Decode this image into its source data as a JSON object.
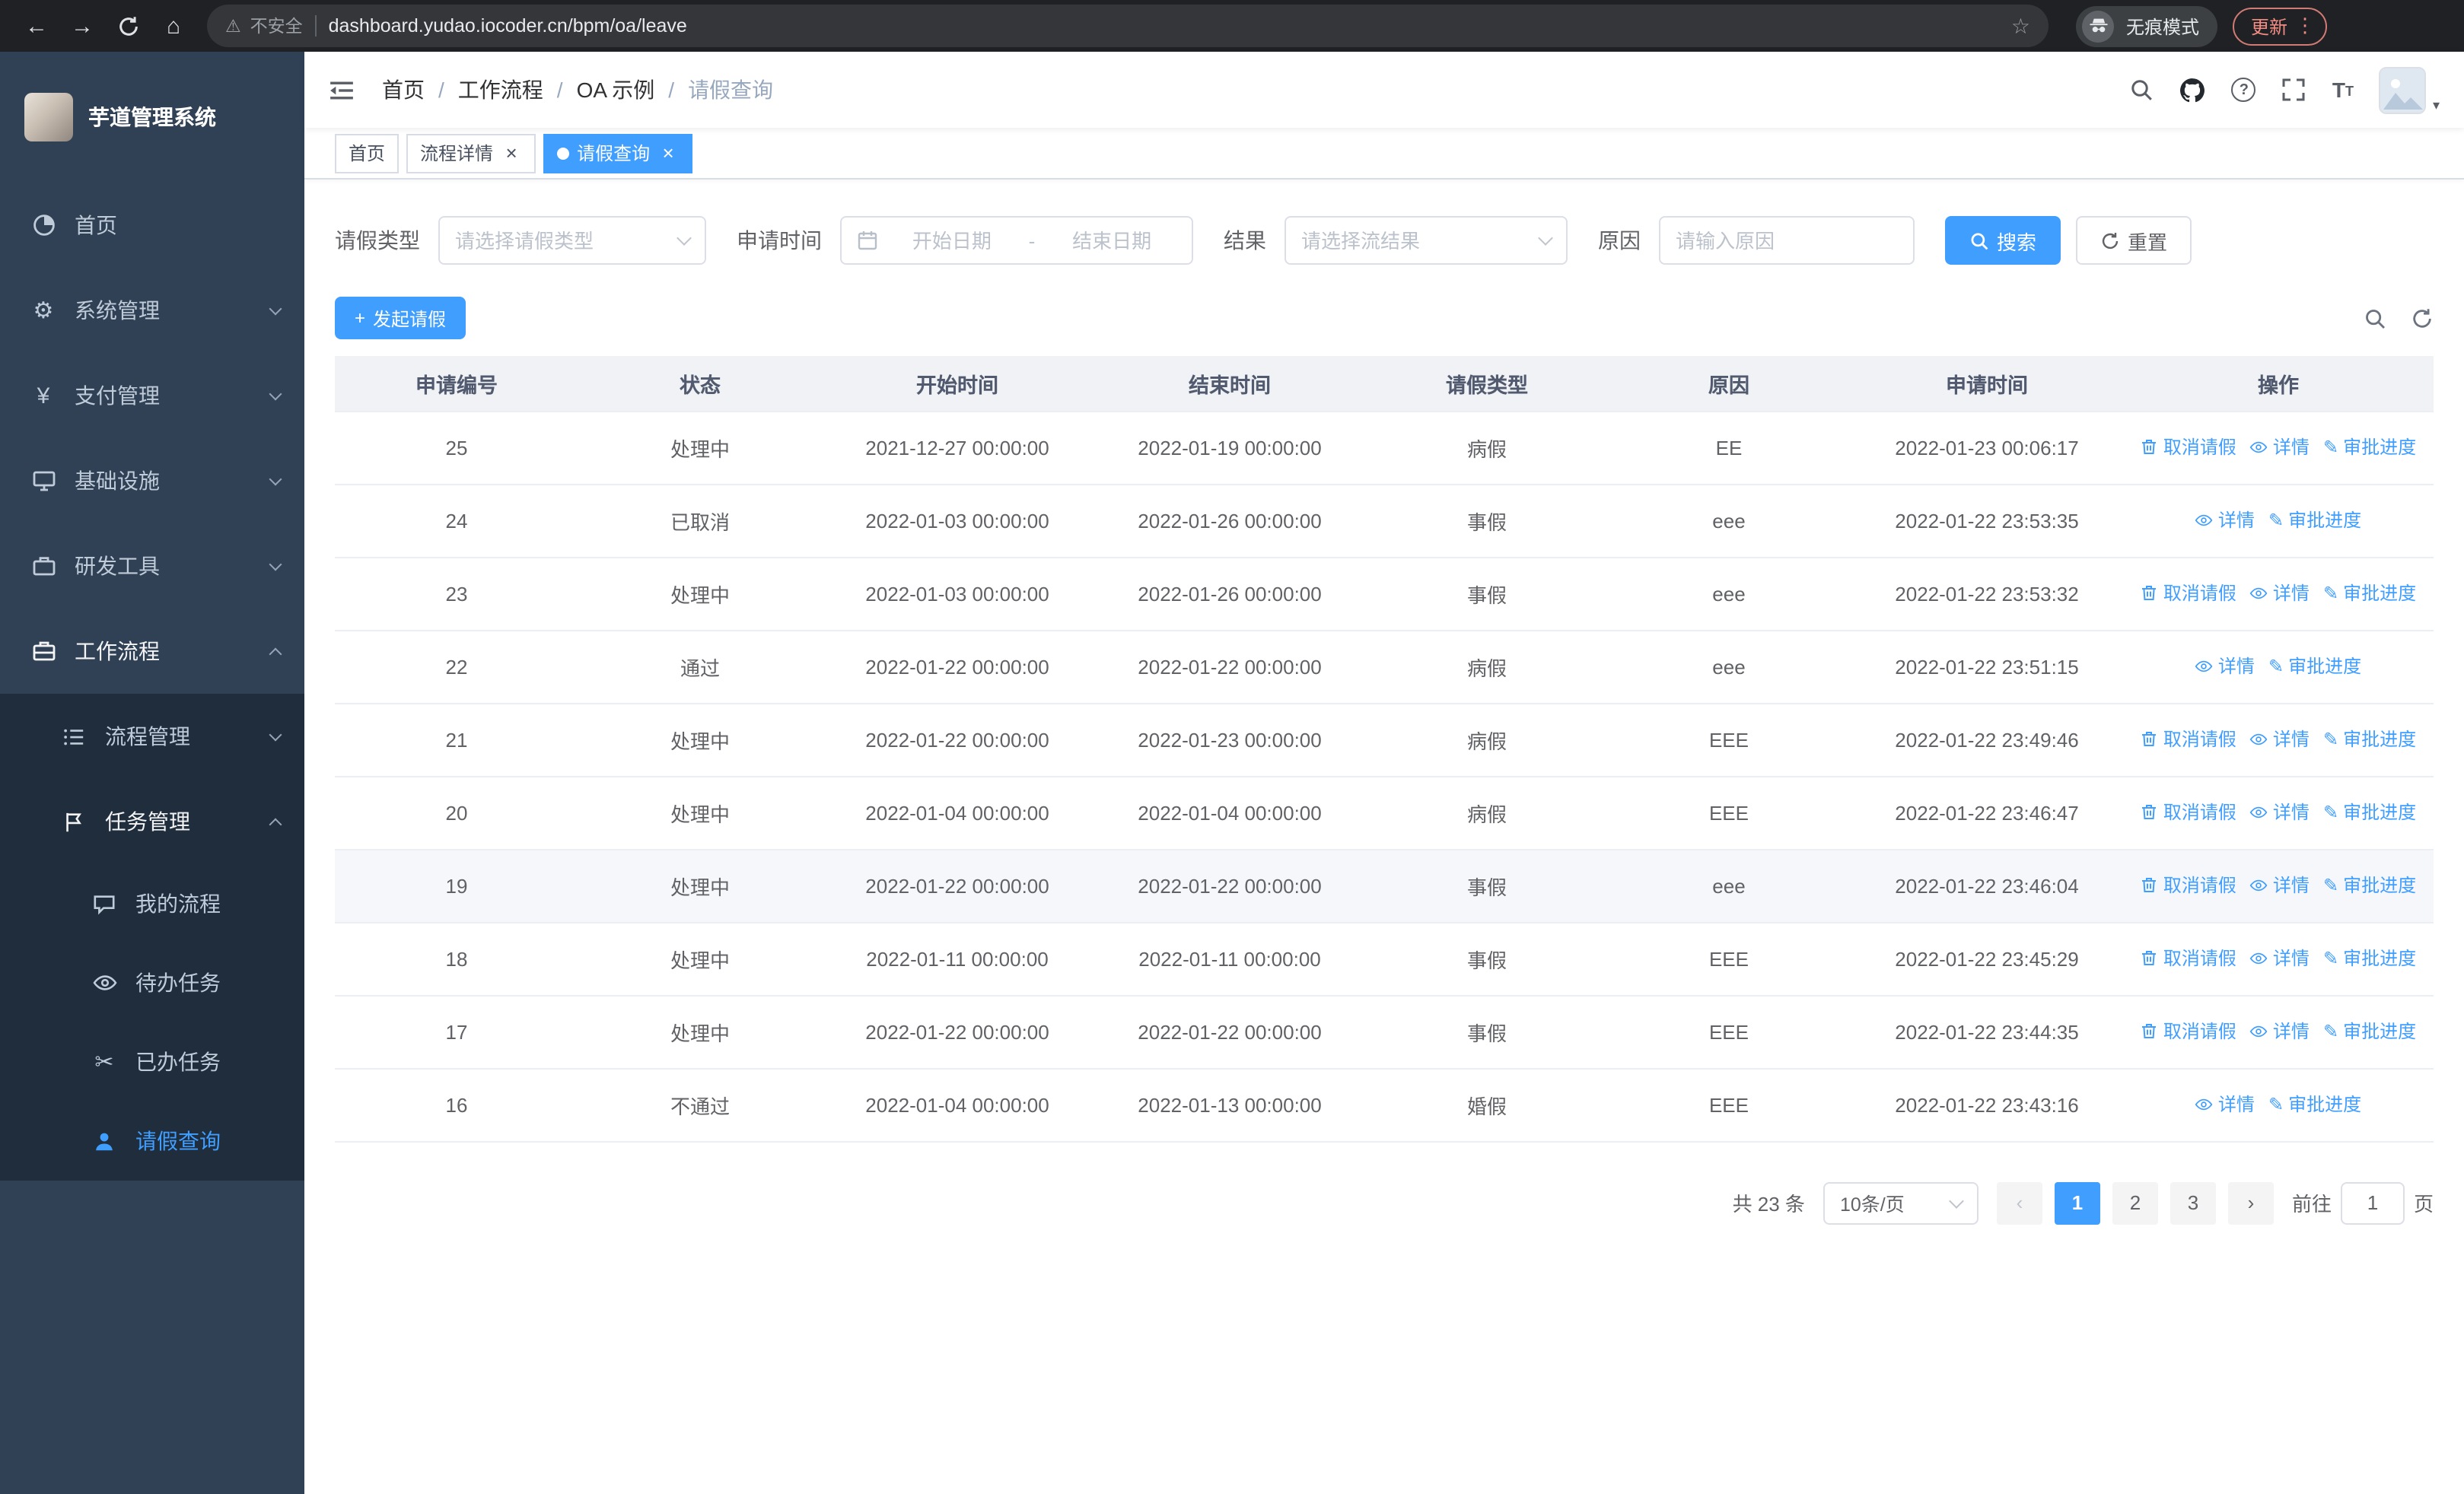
{
  "browser": {
    "security_warning": "不安全",
    "url": "dashboard.yudao.iocoder.cn/bpm/oa/leave",
    "incognito_label": "无痕模式",
    "update_label": "更新"
  },
  "icons": {
    "back": "←",
    "forward": "→",
    "home": "⌂",
    "warning": "⚠",
    "star": "☆",
    "kebab": "⋮",
    "caret": "▾",
    "gear": "⚙",
    "yen": "¥",
    "scissors": "✂",
    "edit": "✎",
    "close": "×",
    "plus": "+",
    "prev": "‹",
    "next": "›",
    "slash": "/",
    "question": "?",
    "font_size": "T"
  },
  "sidebar": {
    "logo_title": "芋道管理系统",
    "menu": [
      {
        "label": "首页"
      },
      {
        "label": "系统管理"
      },
      {
        "label": "支付管理"
      },
      {
        "label": "基础设施"
      },
      {
        "label": "研发工具"
      },
      {
        "label": "工作流程"
      }
    ],
    "workflow_submenu": [
      {
        "label": "流程管理"
      },
      {
        "label": "任务管理"
      }
    ],
    "task_submenu": [
      {
        "label": "我的流程"
      },
      {
        "label": "待办任务"
      },
      {
        "label": "已办任务"
      },
      {
        "label": "请假查询"
      }
    ]
  },
  "header": {
    "breadcrumb": [
      "首页",
      "工作流程",
      "OA 示例",
      "请假查询"
    ]
  },
  "tabs": [
    {
      "label": "首页"
    },
    {
      "label": "流程详情"
    },
    {
      "label": "请假查询"
    }
  ],
  "filters": {
    "leave_type_label": "请假类型",
    "leave_type_placeholder": "请选择请假类型",
    "apply_time_label": "申请时间",
    "start_placeholder": "开始日期",
    "range_separator": "-",
    "end_placeholder": "结束日期",
    "result_label": "结果",
    "result_placeholder": "请选择流结果",
    "reason_label": "原因",
    "reason_placeholder": "请输入原因",
    "search_label": "搜索",
    "reset_label": "重置"
  },
  "toolbar": {
    "create_label": "发起请假"
  },
  "table": {
    "columns": [
      "申请编号",
      "状态",
      "开始时间",
      "结束时间",
      "请假类型",
      "原因",
      "申请时间",
      "操作"
    ],
    "ops": {
      "cancel": "取消请假",
      "detail": "详情",
      "progress": "审批进度"
    },
    "rows": [
      {
        "id": "25",
        "status": "处理中",
        "start": "2021-12-27 00:00:00",
        "end": "2022-01-19 00:00:00",
        "type": "病假",
        "reason": "EE",
        "applied": "2022-01-23 00:06:17",
        "actions": [
          "cancel",
          "detail",
          "progress"
        ]
      },
      {
        "id": "24",
        "status": "已取消",
        "start": "2022-01-03 00:00:00",
        "end": "2022-01-26 00:00:00",
        "type": "事假",
        "reason": "eee",
        "applied": "2022-01-22 23:53:35",
        "actions": [
          "detail",
          "progress"
        ]
      },
      {
        "id": "23",
        "status": "处理中",
        "start": "2022-01-03 00:00:00",
        "end": "2022-01-26 00:00:00",
        "type": "事假",
        "reason": "eee",
        "applied": "2022-01-22 23:53:32",
        "actions": [
          "cancel",
          "detail",
          "progress"
        ]
      },
      {
        "id": "22",
        "status": "通过",
        "start": "2022-01-22 00:00:00",
        "end": "2022-01-22 00:00:00",
        "type": "病假",
        "reason": "eee",
        "applied": "2022-01-22 23:51:15",
        "actions": [
          "detail",
          "progress"
        ]
      },
      {
        "id": "21",
        "status": "处理中",
        "start": "2022-01-22 00:00:00",
        "end": "2022-01-23 00:00:00",
        "type": "病假",
        "reason": "EEE",
        "applied": "2022-01-22 23:49:46",
        "actions": [
          "cancel",
          "detail",
          "progress"
        ]
      },
      {
        "id": "20",
        "status": "处理中",
        "start": "2022-01-04 00:00:00",
        "end": "2022-01-04 00:00:00",
        "type": "病假",
        "reason": "EEE",
        "applied": "2022-01-22 23:46:47",
        "actions": [
          "cancel",
          "detail",
          "progress"
        ]
      },
      {
        "id": "19",
        "status": "处理中",
        "start": "2022-01-22 00:00:00",
        "end": "2022-01-22 00:00:00",
        "type": "事假",
        "reason": "eee",
        "applied": "2022-01-22 23:46:04",
        "actions": [
          "cancel",
          "detail",
          "progress"
        ]
      },
      {
        "id": "18",
        "status": "处理中",
        "start": "2022-01-11 00:00:00",
        "end": "2022-01-11 00:00:00",
        "type": "事假",
        "reason": "EEE",
        "applied": "2022-01-22 23:45:29",
        "actions": [
          "cancel",
          "detail",
          "progress"
        ]
      },
      {
        "id": "17",
        "status": "处理中",
        "start": "2022-01-22 00:00:00",
        "end": "2022-01-22 00:00:00",
        "type": "事假",
        "reason": "EEE",
        "applied": "2022-01-22 23:44:35",
        "actions": [
          "cancel",
          "detail",
          "progress"
        ]
      },
      {
        "id": "16",
        "status": "不通过",
        "start": "2022-01-04 00:00:00",
        "end": "2022-01-13 00:00:00",
        "type": "婚假",
        "reason": "EEE",
        "applied": "2022-01-22 23:43:16",
        "actions": [
          "detail",
          "progress"
        ]
      }
    ]
  },
  "pagination": {
    "total": "共 23 条",
    "page_size": "10条/页",
    "pages": [
      "1",
      "2",
      "3"
    ],
    "active_page": "1",
    "goto_label": "前往",
    "goto_value": "1",
    "goto_unit": "页"
  }
}
